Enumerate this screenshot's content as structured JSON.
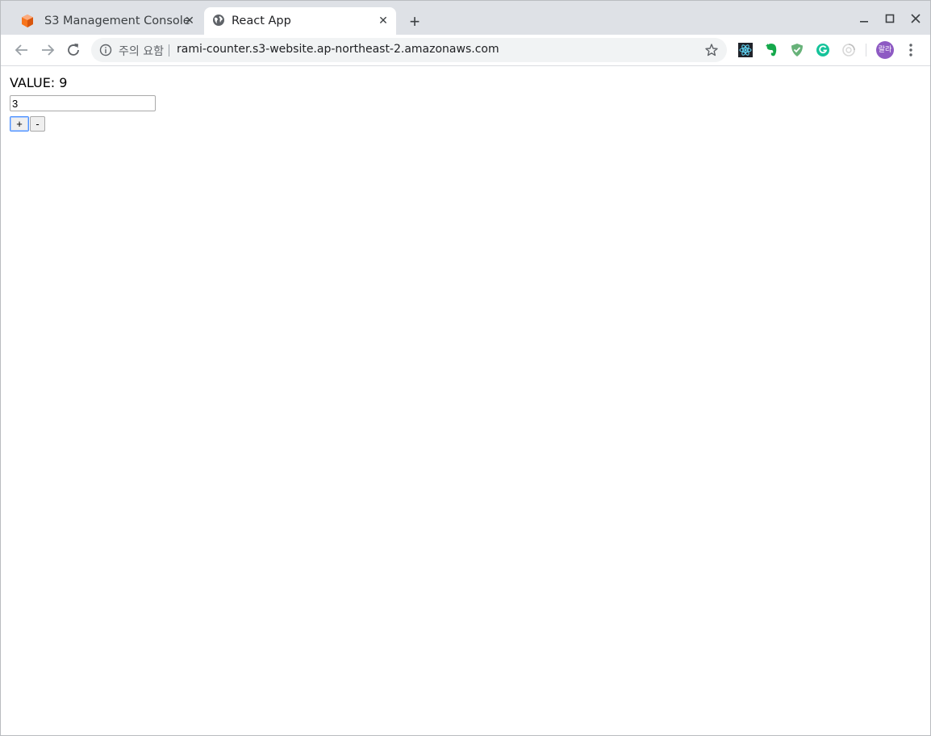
{
  "browser": {
    "tabs": [
      {
        "title": "S3 Management Console",
        "active": false,
        "favicon": "aws-cube-icon"
      },
      {
        "title": "React App",
        "active": true,
        "favicon": "globe-icon"
      }
    ],
    "new_tab": "+",
    "address_bar": {
      "security_label": "주의 요함",
      "url": "rami-counter.s3-website.ap-northeast-2.amazonaws.com"
    },
    "extensions": [
      "react-devtools-icon",
      "evernote-icon",
      "adguard-shield-icon",
      "grammarly-icon",
      "loading-extension-icon"
    ],
    "profile_initials": "랄라"
  },
  "page": {
    "value_label": "VALUE: 9",
    "input_value": "3",
    "plus_label": "+",
    "minus_label": "-"
  },
  "colors": {
    "tabstrip_bg": "#dee1e6",
    "omnibox_bg": "#f1f3f4",
    "avatar_bg": "#8e5ac3",
    "aws_orange": "#f7741b"
  }
}
